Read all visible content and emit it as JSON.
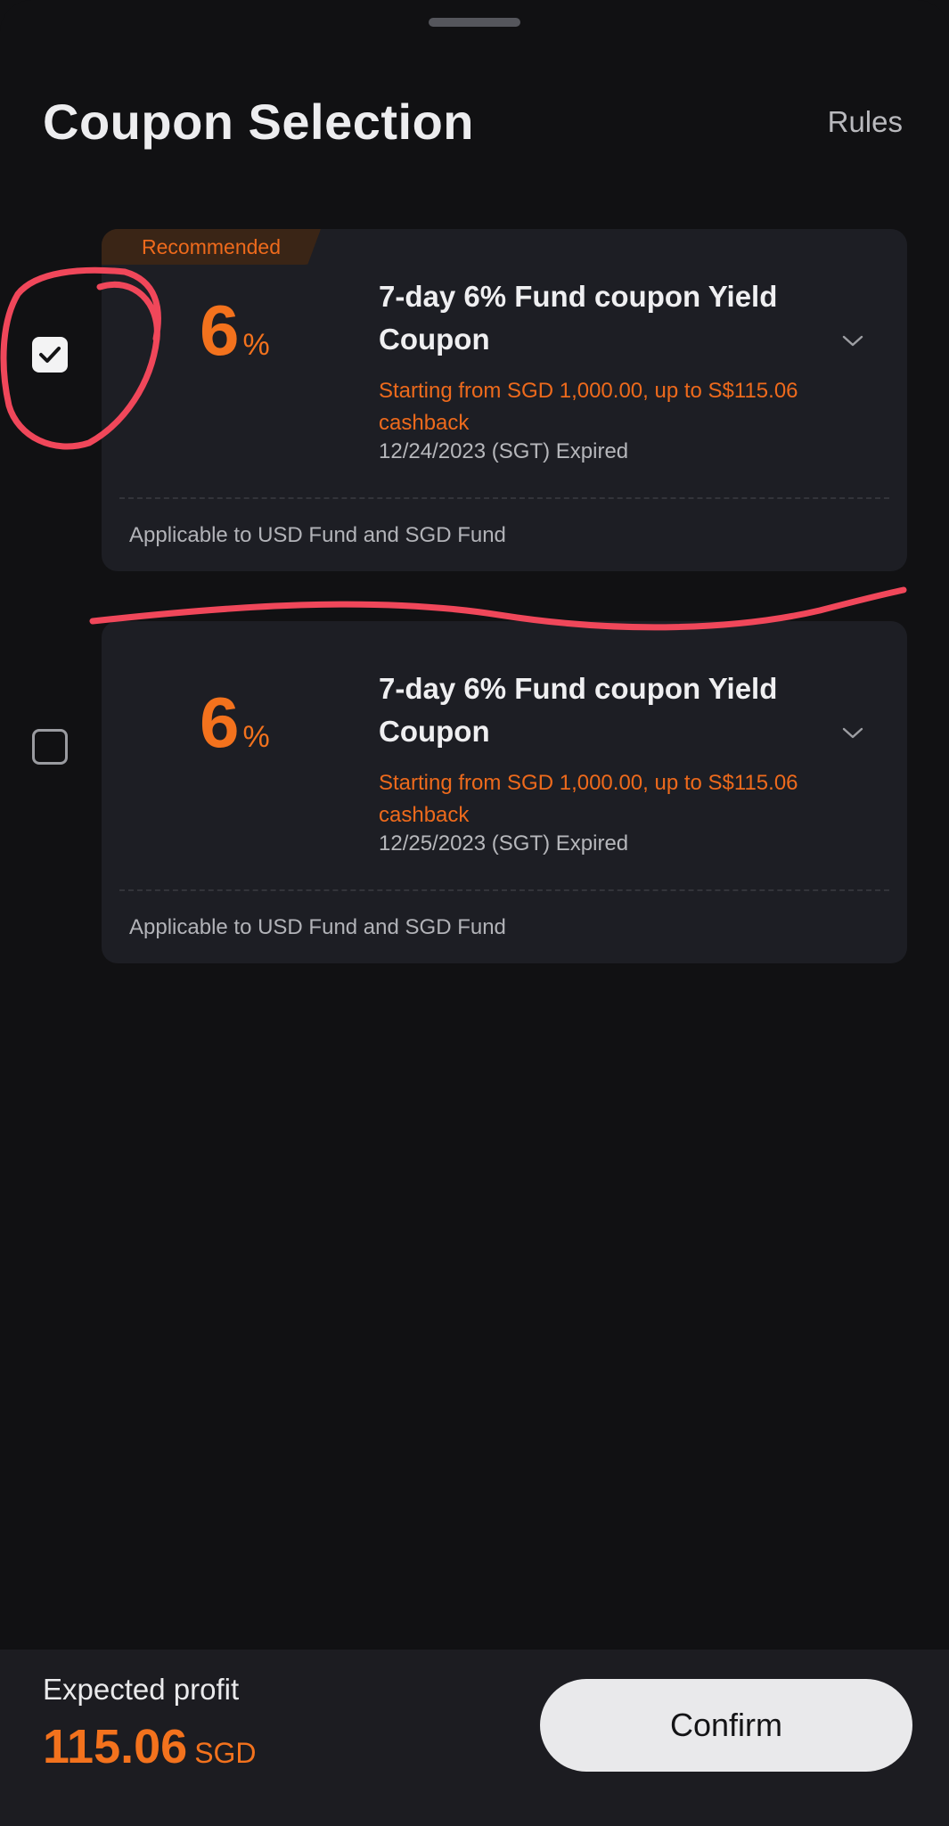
{
  "header": {
    "title": "Coupon Selection",
    "rules_label": "Rules"
  },
  "coupons": [
    {
      "badge": "Recommended",
      "rate_number": "6",
      "rate_unit": "%",
      "title": "7-day 6% Fund coupon Yield Coupon",
      "description": "Starting from SGD 1,000.00, up to S$115.06 cashback",
      "expiry": "12/24/2023 (SGT) Expired",
      "applicability": "Applicable to USD Fund and SGD Fund",
      "selected": true
    },
    {
      "rate_number": "6",
      "rate_unit": "%",
      "title": "7-day 6% Fund coupon Yield Coupon",
      "description": "Starting from SGD 1,000.00, up to S$115.06 cashback",
      "expiry": "12/25/2023 (SGT) Expired",
      "applicability": "Applicable to USD Fund and SGD Fund",
      "selected": false
    }
  ],
  "footer": {
    "expected_profit_label": "Expected profit",
    "profit_amount": "115.06",
    "profit_currency": "SGD",
    "confirm_label": "Confirm"
  },
  "colors": {
    "background": "#111113",
    "card": "#1d1e24",
    "accent": "#f3721d",
    "annotation": "#f0475a"
  }
}
